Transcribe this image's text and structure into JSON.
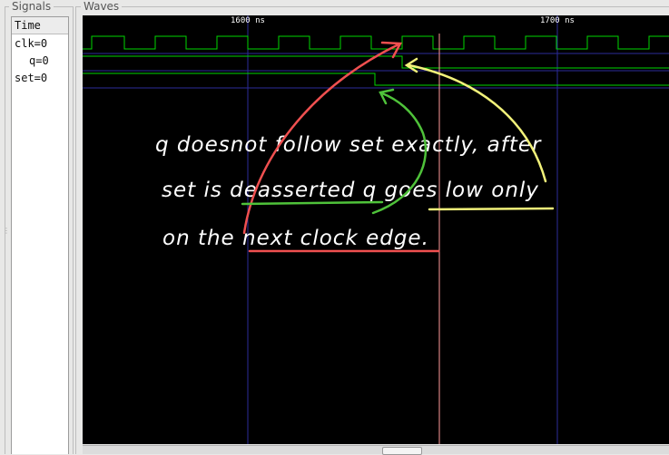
{
  "signals_panel": {
    "title": "Signals",
    "time_header": "Time",
    "rows": [
      {
        "label": "clk=0"
      },
      {
        "label": "q=0"
      },
      {
        "label": "set=0"
      }
    ]
  },
  "waves_panel": {
    "title": "Waves",
    "time_markers": [
      "1600 ns",
      "1700 ns"
    ]
  },
  "annotation": {
    "line1": "q doesnot follow set exactly, after",
    "line2": "set is deasserted   q goes low only",
    "line3": "on the next clock edge."
  },
  "colors": {
    "wave_green": "#00d600",
    "marker_blue": "#2b2b9a",
    "cursor": "#ff9a9a",
    "ink_red": "#f05050",
    "ink_green": "#4fc23a",
    "ink_yellow": "#f2f27a"
  }
}
